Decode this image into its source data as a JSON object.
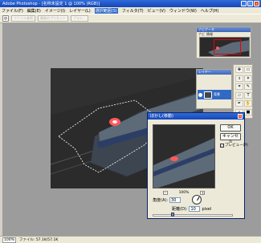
{
  "window": {
    "title": "Adobe Photoshop - [名称未設定 1 @ 100% (RGB)]"
  },
  "menu": [
    "ファイル(F)",
    "編集(E)",
    "イメージ(I)",
    "レイヤー(L)",
    "選択範囲(S)",
    "フィルタ(T)",
    "ビュー(V)",
    "ウィンドウ(W)",
    "ヘルプ(H)"
  ],
  "menu_highlight_index": 4,
  "options": {
    "btn1": "ファイル参照",
    "btn2": "最後のプリセット",
    "btn3": "ブラシ..."
  },
  "navigator": {
    "title": "ナビゲータ",
    "tab1": "情報",
    "tab2": "ナビ"
  },
  "layers": {
    "title": "レイヤー",
    "layer_name": "背景"
  },
  "dialog": {
    "title": "ぼかし(移動)",
    "ok": "OK",
    "cancel": "キャンセル",
    "preview_label": "プレビュー(P)",
    "zoom": "100%",
    "zoom_minus": "−",
    "zoom_plus": "+",
    "angle_label": "角度(A):",
    "angle_value": "30",
    "distance_label": "距離(D):",
    "distance_value": "10",
    "distance_unit": "pixel"
  },
  "status": {
    "zoom": "100%",
    "info": "ファイル: 57.1K/57.1K"
  },
  "colors": {
    "title": "#1646b8",
    "selection": "#316ac5",
    "workspace": "#9c9c9c"
  }
}
